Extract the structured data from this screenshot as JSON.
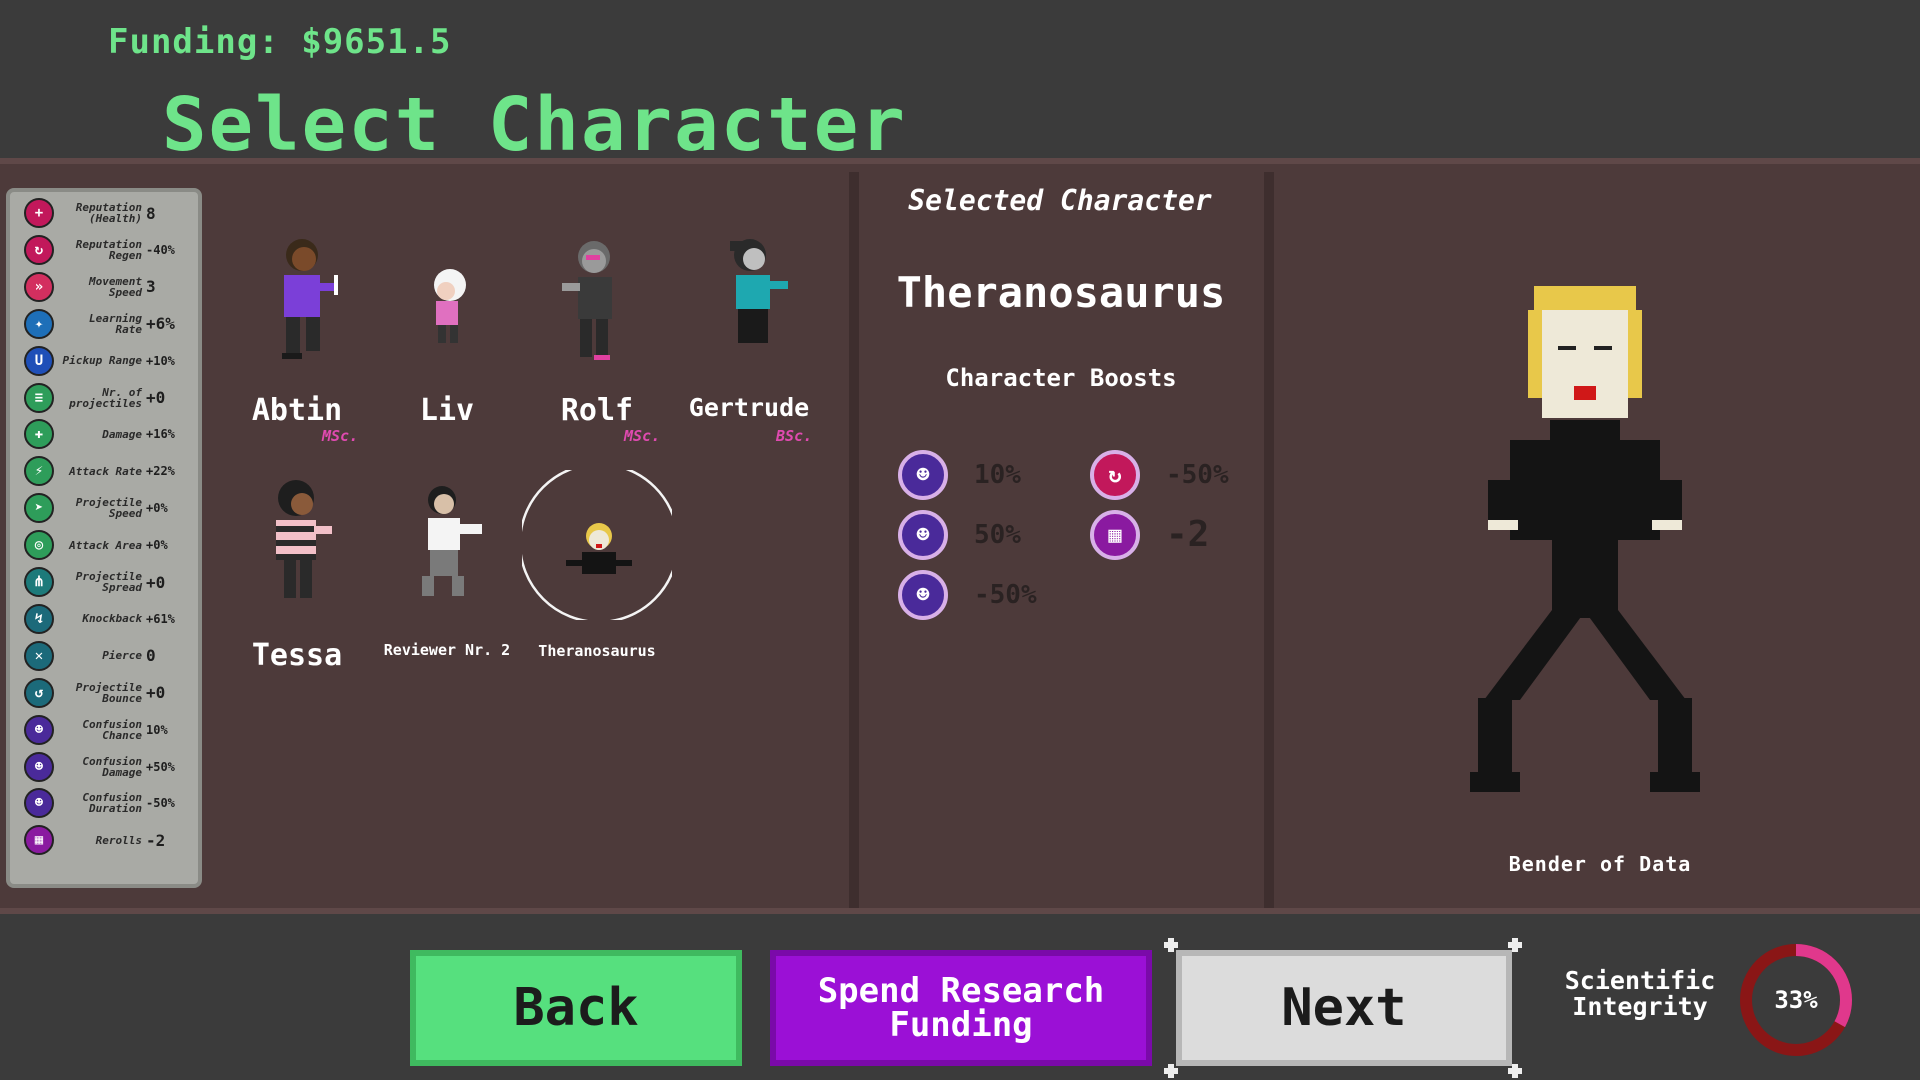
{
  "header": {
    "funding": "Funding: $9651.5",
    "title": "Select Character"
  },
  "stats": [
    {
      "label": "Reputation (Health)",
      "value": "8",
      "icon": "plus-icon",
      "color": "#c2185b",
      "small": false
    },
    {
      "label": "Reputation Regen",
      "value": "-40%",
      "icon": "regen-icon",
      "color": "#c2185b",
      "small": true
    },
    {
      "label": "Movement Speed",
      "value": "3",
      "icon": "speed-icon",
      "color": "#d32f5f",
      "small": false
    },
    {
      "label": "Learning Rate",
      "value": "+6%",
      "icon": "learning-icon",
      "color": "#1e6fb8",
      "small": false
    },
    {
      "label": "Pickup Range",
      "value": "+10%",
      "icon": "magnet-icon",
      "color": "#1e4fb8",
      "small": true
    },
    {
      "label": "Nr. of projectiles",
      "value": "+0",
      "icon": "projectiles-icon",
      "color": "#2e9d5a",
      "small": false
    },
    {
      "label": "Damage",
      "value": "+16%",
      "icon": "damage-icon",
      "color": "#2e9d5a",
      "small": true
    },
    {
      "label": "Attack Rate",
      "value": "+22%",
      "icon": "attack-rate-icon",
      "color": "#2e9d5a",
      "small": true
    },
    {
      "label": "Projectile Speed",
      "value": "+0%",
      "icon": "projectile-speed-icon",
      "color": "#2e9d5a",
      "small": true
    },
    {
      "label": "Attack Area",
      "value": "+0%",
      "icon": "attack-area-icon",
      "color": "#2e9d5a",
      "small": true
    },
    {
      "label": "Projectile Spread",
      "value": "+0",
      "icon": "spread-icon",
      "color": "#1c7a7a",
      "small": false
    },
    {
      "label": "Knockback",
      "value": "+61%",
      "icon": "knockback-icon",
      "color": "#1c6a7a",
      "small": true
    },
    {
      "label": "Pierce",
      "value": "0",
      "icon": "pierce-icon",
      "color": "#1c6a7a",
      "small": false
    },
    {
      "label": "Projectile Bounce",
      "value": "+0",
      "icon": "bounce-icon",
      "color": "#1c6a7a",
      "small": false
    },
    {
      "label": "Confusion Chance",
      "value": "10%",
      "icon": "confusion-chance-icon",
      "color": "#4a2a9a",
      "small": true
    },
    {
      "label": "Confusion Damage",
      "value": "+50%",
      "icon": "confusion-damage-icon",
      "color": "#4a2a9a",
      "small": true
    },
    {
      "label": "Confusion Duration",
      "value": "-50%",
      "icon": "confusion-duration-icon",
      "color": "#4a2a9a",
      "small": true
    },
    {
      "label": "Rerolls",
      "value": "-2",
      "icon": "dice-icon",
      "color": "#8a1aa0",
      "small": false
    }
  ],
  "characters": [
    {
      "name": "Abtin",
      "degree": "MSc."
    },
    {
      "name": "Liv",
      "degree": ""
    },
    {
      "name": "Rolf",
      "degree": "MSc."
    },
    {
      "name": "Gertrude",
      "degree": "BSc."
    },
    {
      "name": "Tessa",
      "degree": ""
    },
    {
      "name": "Reviewer Nr. 2",
      "degree": ""
    },
    {
      "name": "Theranosaurus",
      "degree": ""
    }
  ],
  "selected": {
    "heading": "Selected Character",
    "name": "Theranosaurus",
    "boosts_heading": "Character Boosts",
    "boosts": [
      {
        "value": "10%",
        "icon": "confusion-chance-icon",
        "color": "#4a2a9a"
      },
      {
        "value": "-50%",
        "icon": "regen-icon",
        "color": "#c2185b"
      },
      {
        "value": "50%",
        "icon": "confusion-damage-icon",
        "color": "#4a2a9a"
      },
      {
        "value": "-2",
        "icon": "dice-icon",
        "color": "#8a1aa0"
      },
      {
        "value": "-50%",
        "icon": "confusion-duration-icon",
        "color": "#4a2a9a"
      }
    ],
    "subtitle": "Bender of Data"
  },
  "footer": {
    "back": "Back",
    "spend": "Spend Research Funding",
    "next": "Next",
    "integrity_label": "Scientific Integrity",
    "integrity_value": "33%",
    "integrity_fraction": 0.33
  },
  "colors": {
    "accent_green": "#6ee48a",
    "panel_bg": "#4d3a3a",
    "degree_pink": "#e04ab0",
    "gauge_fill": "#e0388c",
    "gauge_track": "#8a1616"
  }
}
